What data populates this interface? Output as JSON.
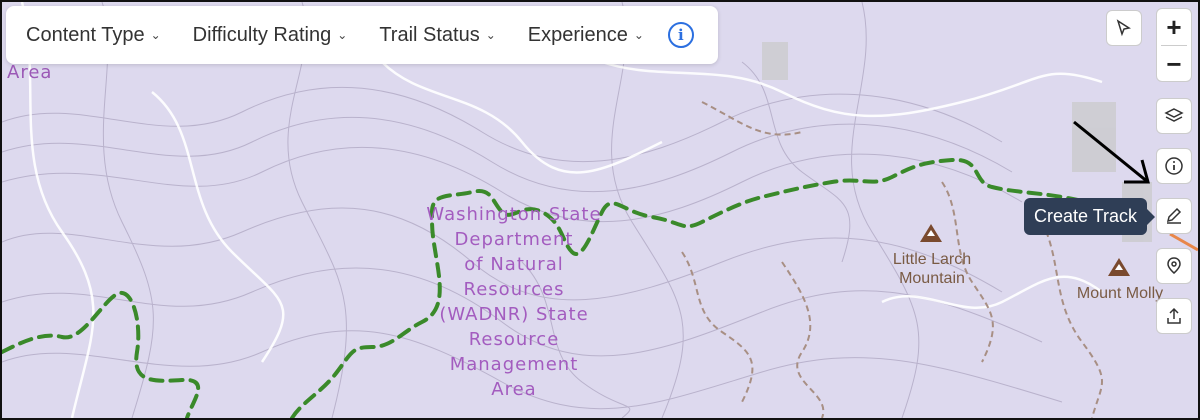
{
  "filters": [
    {
      "label": "Content Type"
    },
    {
      "label": "Difficulty Rating"
    },
    {
      "label": "Trail Status"
    },
    {
      "label": "Experience"
    }
  ],
  "map": {
    "area_label": "Area",
    "wadnr_label": "Washington State\nDepartment\nof Natural\nResources\n(WADNR) State\nResource\nManagement\nArea",
    "peaks": [
      {
        "name": "Little Larch\nMountain"
      },
      {
        "name": "Mount Molly"
      }
    ]
  },
  "controls": {
    "zoom_in": "+",
    "zoom_out": "−",
    "tooltip": "Create Track",
    "icons": [
      "cursor-icon",
      "layers-icon",
      "info-icon",
      "pencil-icon",
      "location-pin-icon",
      "upload-icon"
    ]
  },
  "colors": {
    "map_bg": "#ddd9ee",
    "trail_green": "#3a8a2a",
    "contour": "#b9b2cc",
    "road": "#ffffff",
    "tooltip_bg": "#2f3e56",
    "info_blue": "#2b6fe0"
  }
}
